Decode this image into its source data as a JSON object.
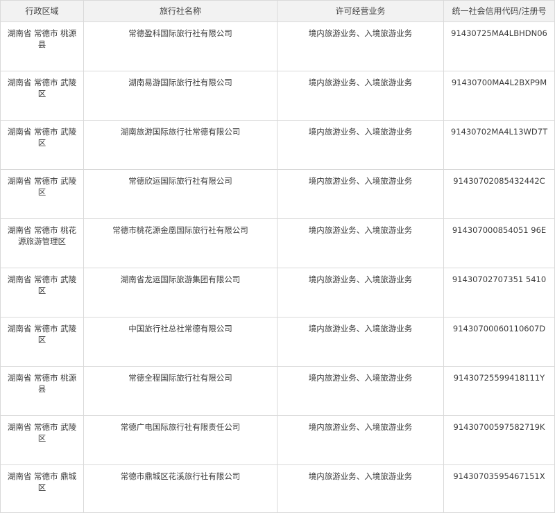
{
  "table": {
    "headers": [
      "行政区域",
      "旅行社名称",
      "许可经营业务",
      "统一社会信用代码/注册号"
    ],
    "rows": [
      [
        "湖南省 常德市 桃源县",
        "常德盈科国际旅行社有限公司",
        "境内旅游业务、入境旅游业务",
        "91430725MA4LBHDN06"
      ],
      [
        "湖南省 常德市 武陵区",
        "湖南易游国际旅行社有限公司",
        "境内旅游业务、入境旅游业务",
        "91430700MA4L2BXP9M"
      ],
      [
        "湖南省 常德市 武陵区",
        "湖南旅游国际旅行社常德有限公司",
        "境内旅游业务、入境旅游业务",
        "91430702MA4L13WD7T"
      ],
      [
        "湖南省 常德市 武陵区",
        "常德欣运国际旅行社有限公司",
        "境内旅游业务、入境旅游业务",
        "91430702085432442C"
      ],
      [
        "湖南省 常德市 桃花源旅游管理区",
        "常德市桃花源金凰国际旅行社有限公司",
        "境内旅游业务、入境旅游业务",
        "914307000854051 96E"
      ],
      [
        "湖南省 常德市 武陵区",
        "湖南省龙运国际旅游集团有限公司",
        "境内旅游业务、入境旅游业务",
        "91430702707351 5410"
      ],
      [
        "湖南省 常德市 武陵区",
        "中国旅行社总社常德有限公司",
        "境内旅游业务、入境旅游业务",
        "91430700060110607D"
      ],
      [
        "湖南省 常德市 桃源县",
        "常德全程国际旅行社有限公司",
        "境内旅游业务、入境旅游业务",
        "91430725599418111Y"
      ],
      [
        "湖南省 常德市 武陵区",
        "常德广电国际旅行社有限责任公司",
        "境内旅游业务、入境旅游业务",
        "91430700597582719K"
      ],
      [
        "湖南省 常德市 鼎城区",
        "常德市鼎城区花溪旅行社有限公司",
        "境内旅游业务、入境旅游业务",
        "91430703595467151X"
      ]
    ]
  }
}
